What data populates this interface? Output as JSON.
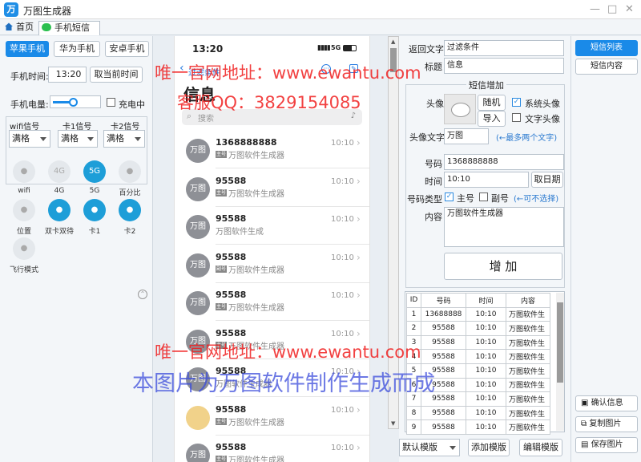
{
  "app": {
    "title": "万图生成器",
    "logo": "万"
  },
  "tabs": [
    {
      "label": "首页"
    },
    {
      "label": "手机短信"
    }
  ],
  "left": {
    "phone_types": [
      "苹果手机",
      "华为手机",
      "安卓手机"
    ],
    "time_label": "手机时间:",
    "time_value": "13:20",
    "now_btn": "取当前时间",
    "battery_label": "手机电量:",
    "charging_label": "充电中",
    "battery_level": 0.45,
    "signals": [
      {
        "label": "wifi信号",
        "value": "满格"
      },
      {
        "label": "卡1信号",
        "value": "满格"
      },
      {
        "label": "卡2信号",
        "value": "满格"
      }
    ],
    "quick": [
      {
        "icon": "wifi-icon",
        "label": "wifi",
        "on": false
      },
      {
        "icon": "4g-icon",
        "label": "4G",
        "on": false,
        "glyph": "4G"
      },
      {
        "icon": "5g-icon",
        "label": "5G",
        "on": true,
        "glyph": "5G"
      },
      {
        "icon": "battery-percent-icon",
        "label": "百分比",
        "on": false
      },
      {
        "icon": "location-icon",
        "label": "位置",
        "on": false
      },
      {
        "icon": "dual-sim-icon",
        "label": "双卡双待",
        "on": true
      },
      {
        "icon": "sim1-signal-icon",
        "label": "卡1",
        "on": true
      },
      {
        "icon": "sim2-signal-icon",
        "label": "卡2",
        "on": true
      },
      {
        "icon": "airplane-icon",
        "label": "飞行模式",
        "on": false
      }
    ]
  },
  "phone": {
    "time": "13:20",
    "network": "5G",
    "back_label": "过滤条件",
    "title": "信息",
    "search_placeholder": "搜索",
    "messages": [
      {
        "avatar": "万图",
        "name": "1368888888",
        "tag": "主号",
        "preview": "万图软件生成器",
        "time": "10:10"
      },
      {
        "avatar": "万图",
        "name": "95588",
        "tag": "主号",
        "preview": "万图软件生成器",
        "time": "10:10"
      },
      {
        "avatar": "万图",
        "name": "95588",
        "tag": "",
        "preview": "万图软件生成",
        "time": "10:10"
      },
      {
        "avatar": "万图",
        "name": "95588",
        "tag": "副号",
        "preview": "万图软件生成器",
        "time": "10:10"
      },
      {
        "avatar": "万图",
        "name": "95588",
        "tag": "主号",
        "preview": "万图软件生成器",
        "time": "10:10"
      },
      {
        "avatar": "万图",
        "name": "95588",
        "tag": "主号",
        "preview": "万图软件生成器",
        "time": "10:10"
      },
      {
        "avatar": "万图",
        "name": "95588",
        "tag": "",
        "preview": "万图软件生成器",
        "time": "10:10"
      },
      {
        "avatar": "photo",
        "name": "95588",
        "tag": "主号",
        "preview": "万图软件生成器",
        "time": "10:10"
      },
      {
        "avatar": "万图",
        "name": "95588",
        "tag": "主号",
        "preview": "万图软件生成器",
        "time": "10:10"
      }
    ]
  },
  "right": {
    "back_text_label": "返回文字",
    "back_text_value": "过滤条件",
    "title_label": "标题",
    "title_value": "信息",
    "group_title": "短信增加",
    "avatar_label": "头像",
    "random_btn": "随机",
    "import_btn": "导入",
    "system_avatar": "系统头像",
    "text_avatar": "文字头像",
    "avatar_text_label": "头像文字",
    "avatar_text_value": "万图",
    "avatar_text_hint": "(←最多两个文字)",
    "number_label": "号码",
    "number_value": "1368888888",
    "time_label": "时间",
    "time_value": "10:10",
    "get_date_btn": "取日期",
    "number_type_label": "号码类型",
    "main_label": "主号",
    "sub_label": "副号",
    "optional_hint": "(←可不选择)",
    "content_label": "内容",
    "content_value": "万图软件生成器",
    "add_btn": "增 加",
    "table": {
      "headers": [
        "ID",
        "号码",
        "时间",
        "内容"
      ],
      "rows": [
        [
          "1",
          "13688888",
          "10:10",
          "万图软件生"
        ],
        [
          "2",
          "95588",
          "10:10",
          "万图软件生"
        ],
        [
          "3",
          "95588",
          "10:10",
          "万图软件生"
        ],
        [
          "4",
          "95588",
          "10:10",
          "万图软件生"
        ],
        [
          "5",
          "95588",
          "10:10",
          "万图软件生"
        ],
        [
          "6",
          "95588",
          "10:10",
          "万图软件生"
        ],
        [
          "7",
          "95588",
          "10:10",
          "万图软件生"
        ],
        [
          "8",
          "95588",
          "10:10",
          "万图软件生"
        ],
        [
          "9",
          "95588",
          "10:10",
          "万图软件生"
        ]
      ]
    },
    "template_value": "默认模版",
    "add_template_btn": "添加模版",
    "edit_template_btn": "编辑模版"
  },
  "far": {
    "list_btn": "短信列表",
    "content_btn": "短信内容",
    "confirm_btn": "确认信息",
    "copy_btn": "复制图片",
    "save_btn": "保存图片"
  },
  "watermarks": {
    "site1": "唯一官网地址：www.ewantu.com",
    "qq": "客服QQ：3829154085",
    "site2": "唯一官网地址：www.ewantu.com",
    "made": "本图片为万图软件制作生成而成"
  }
}
